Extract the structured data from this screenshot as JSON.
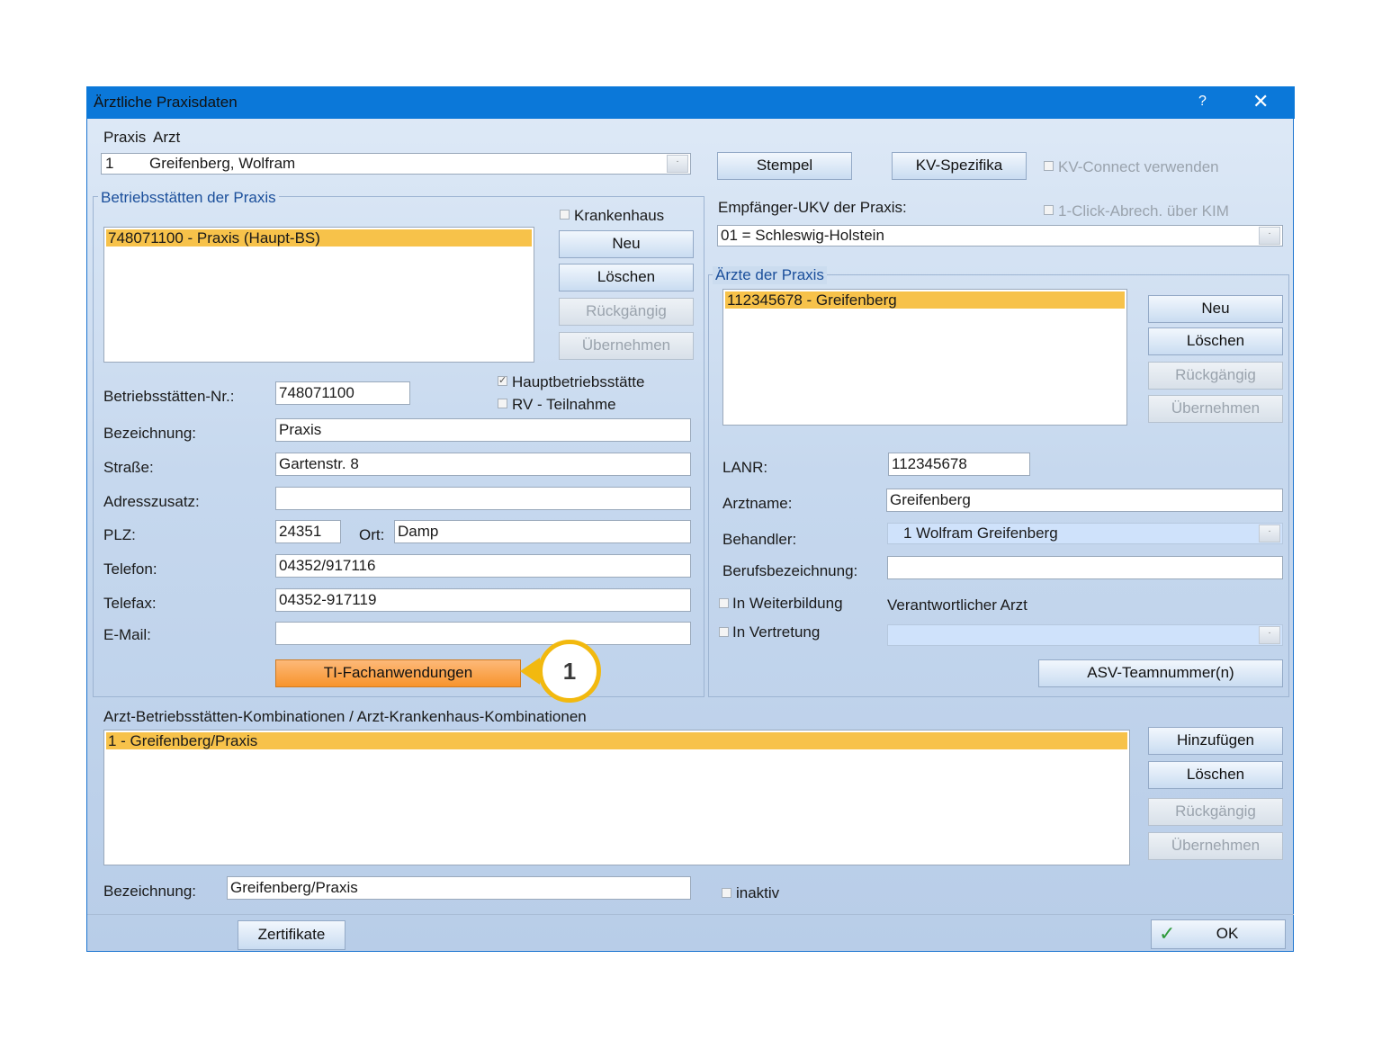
{
  "window": {
    "title": "Ärztliche Praxisdaten",
    "help": "?",
    "close": "✕"
  },
  "header": {
    "praxis_label": "Praxis",
    "arzt_label": "Arzt",
    "praxis_value": "1",
    "arzt_value": "Greifenberg, Wolfram",
    "stempel": "Stempel",
    "kv_spezifika": "KV-Spezifika",
    "kv_connect": "KV-Connect verwenden",
    "one_click": "1-Click-Abrech. über KIM"
  },
  "betriebsstaetten": {
    "group_title": "Betriebsstätten der Praxis",
    "krankenhaus": "Krankenhaus",
    "selected_item": "748071100 - Praxis (Haupt-BS)",
    "buttons": {
      "neu": "Neu",
      "loeschen": "Löschen",
      "rueckgaengig": "Rückgängig",
      "uebernehmen": "Übernehmen"
    },
    "hauptbetriebsstaette": "Hauptbetriebsstätte",
    "rv_teilnahme": "RV - Teilnahme",
    "fields": {
      "nr_label": "Betriebsstätten-Nr.:",
      "nr_value": "748071100",
      "bez_label": "Bezeichnung:",
      "bez_value": "Praxis",
      "strasse_label": "Straße:",
      "strasse_value": "Gartenstr. 8",
      "adresszusatz_label": "Adresszusatz:",
      "adresszusatz_value": "",
      "plz_label": "PLZ:",
      "plz_value": "24351",
      "ort_label": "Ort:",
      "ort_value": "Damp",
      "telefon_label": "Telefon:",
      "telefon_value": "04352/917116",
      "telefax_label": "Telefax:",
      "telefax_value": "04352-917119",
      "email_label": "E-Mail:",
      "email_value": ""
    },
    "ti_button": "TI-Fachanwendungen",
    "callout": "1"
  },
  "empfaenger": {
    "label": "Empfänger-UKV der Praxis:",
    "value": "01 = Schleswig-Holstein"
  },
  "aerzte": {
    "group_title": "Ärzte der Praxis",
    "selected_item": "112345678 - Greifenberg",
    "buttons": {
      "neu": "Neu",
      "loeschen": "Löschen",
      "rueckgaengig": "Rückgängig",
      "uebernehmen": "Übernehmen"
    },
    "lanr_label": "LANR:",
    "lanr_value": "112345678",
    "arztname_label": "Arztname:",
    "arztname_value": "Greifenberg",
    "behandler_label": "Behandler:",
    "behandler_value": "1 Wolfram Greifenberg",
    "beruf_label": "Berufsbezeichnung:",
    "beruf_value": "",
    "weiterbildung": "In Weiterbildung",
    "vertretung": "In Vertretung",
    "verantwortlicher": "Verantwortlicher Arzt",
    "asv_button": "ASV-Teamnummer(n)"
  },
  "kombinationen": {
    "title": "Arzt-Betriebsstätten-Kombinationen / Arzt-Krankenhaus-Kombinationen",
    "selected_item": "1 - Greifenberg/Praxis",
    "buttons": {
      "hinzufuegen": "Hinzufügen",
      "loeschen": "Löschen",
      "rueckgaengig": "Rückgängig",
      "uebernehmen": "Übernehmen"
    },
    "bez_label": "Bezeichnung:",
    "bez_value": "Greifenberg/Praxis",
    "inaktiv": "inaktiv"
  },
  "footer": {
    "zertifikate": "Zertifikate",
    "ok": "OK"
  }
}
